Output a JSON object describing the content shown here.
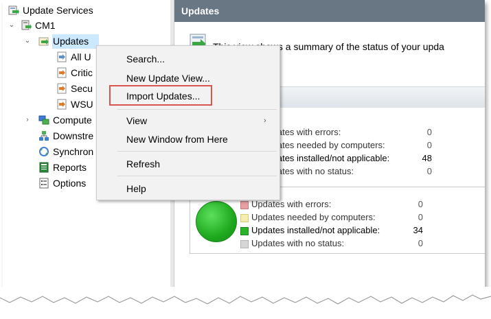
{
  "tree": {
    "root": "Update Services",
    "server": "CM1",
    "updates": "Updates",
    "update_views": [
      "All U",
      "Critic",
      "Secu",
      "WSU"
    ],
    "other_nodes": [
      "Compute",
      "Downstre",
      "Synchron",
      "Reports",
      "Options"
    ]
  },
  "header": {
    "title": "Updates"
  },
  "description": "This view shows a summary of the status of your upda",
  "context_menu": {
    "items": [
      "Search...",
      "New Update View...",
      "Import Updates...",
      "View",
      "New Window from Here",
      "Refresh",
      "Help"
    ]
  },
  "status_group_1": {
    "rows": [
      {
        "label": "Updates with errors:",
        "value": "0"
      },
      {
        "label": "Updates needed by computers:",
        "value": "0"
      },
      {
        "label": "Updates installed/not applicable:",
        "value": "48"
      },
      {
        "label": "Updates with no status:",
        "value": "0"
      }
    ]
  },
  "status_group_2": {
    "rows": [
      {
        "label": "Updates with errors:",
        "value": "0"
      },
      {
        "label": "Updates needed by computers:",
        "value": "0"
      },
      {
        "label": "Updates installed/not applicable:",
        "value": "34"
      },
      {
        "label": "Updates with no status:",
        "value": "0"
      }
    ]
  },
  "colors": {
    "header_bg": "#697785",
    "selection": "#cce8ff",
    "error": "#e8a0a0",
    "needed": "#f4ecb0",
    "installed": "#2bb52b",
    "no_status": "#d6d6d6",
    "highlight_box": "#d9534f"
  },
  "icons": [
    "update-services-icon",
    "server-icon",
    "updates-folder-icon",
    "update-view-icon",
    "computers-icon",
    "downstream-icon",
    "synchronization-icon",
    "reports-icon",
    "options-icon",
    "status-circle-icon"
  ]
}
